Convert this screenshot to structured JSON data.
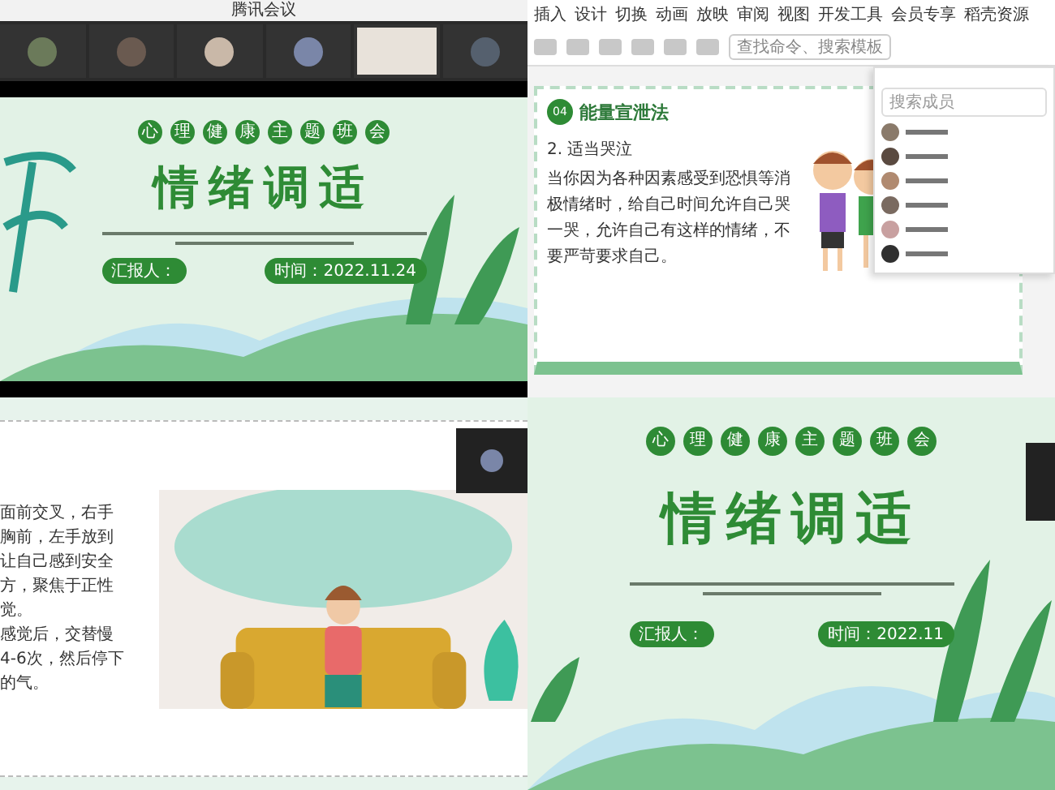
{
  "panels": [
    {
      "kind": "meeting",
      "title": "腾讯会议",
      "participants": [
        {
          "video_on": false,
          "color": "#6b7a5a"
        },
        {
          "video_on": false,
          "color": "#6a5a50"
        },
        {
          "video_on": false,
          "color": "#c9b8a8"
        },
        {
          "video_on": false,
          "color": "#7a86a8"
        },
        {
          "video_on": true,
          "color": "#e8e2da"
        },
        {
          "video_on": false,
          "color": "#55606e"
        }
      ],
      "slide": {
        "circles": [
          "心",
          "理",
          "健",
          "康",
          "主",
          "题",
          "班",
          "会"
        ],
        "title": "情绪调适",
        "presenter": "汇报人：",
        "date": "时间：2022.11.24"
      }
    },
    {
      "kind": "editor",
      "tabs": [
        "插入",
        "设计",
        "切换",
        "动画",
        "放映",
        "审阅",
        "视图",
        "开发工具",
        "会员专享",
        "稻壳资源"
      ],
      "search": "查找命令、搜索模板",
      "badge": "04",
      "section_title": "能量宣泄法",
      "heading": "2. 适当哭泣",
      "paragraph": "当你因为各种因素感受到恐惧等消极情绪时，给自己时间允许自己哭一哭，允许自己有这样的情绪，不要严苛要求自己。",
      "members": {
        "placeholder": "搜索成员",
        "avatars": [
          {
            "color": "#8a7a6a"
          },
          {
            "color": "#5a4a40"
          },
          {
            "color": "#b08a70"
          },
          {
            "color": "#7a6a60"
          },
          {
            "color": "#c8a0a0"
          },
          {
            "color": "#303030"
          }
        ]
      }
    },
    {
      "kind": "breathing",
      "lines": [
        "面前交叉，右手",
        "胸前，左手放到",
        "让自己感到安全",
        "方，聚焦于正性",
        "觉。",
        "感觉后，交替慢",
        "4-6次，然后停下",
        "的气。"
      ]
    },
    {
      "kind": "cover",
      "slide": {
        "circles": [
          "心",
          "理",
          "健",
          "康",
          "主",
          "题",
          "班",
          "会"
        ],
        "title": "情绪调适",
        "presenter": "汇报人：",
        "date": "时间：2022.11"
      }
    }
  ]
}
